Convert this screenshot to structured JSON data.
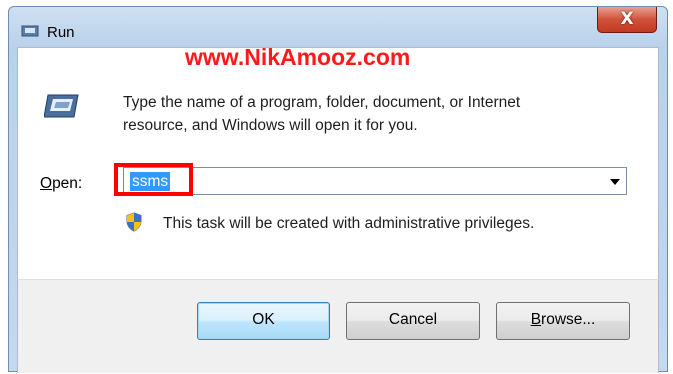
{
  "window": {
    "title": "Run",
    "title_icon": "run-icon",
    "close_symbol": "X"
  },
  "watermark": "www.NikAmooz.com",
  "body": {
    "icon": "run-icon",
    "description_line1": "Type the name of a program, folder, document, or Internet",
    "description_line2": "resource, and Windows will open it for you."
  },
  "open": {
    "label_prefix": "O",
    "label_rest": "pen:",
    "value": "ssms"
  },
  "admin_note": {
    "icon": "shield-icon",
    "text": "This task will be created with administrative privileges."
  },
  "buttons": {
    "ok": "OK",
    "cancel": "Cancel",
    "browse_prefix": "B",
    "browse_rest": "rowse..."
  },
  "colors": {
    "selection": "#3399ff",
    "highlight_box": "#ff0000",
    "watermark": "#ff1a1a",
    "close_button": "#c23a21"
  }
}
